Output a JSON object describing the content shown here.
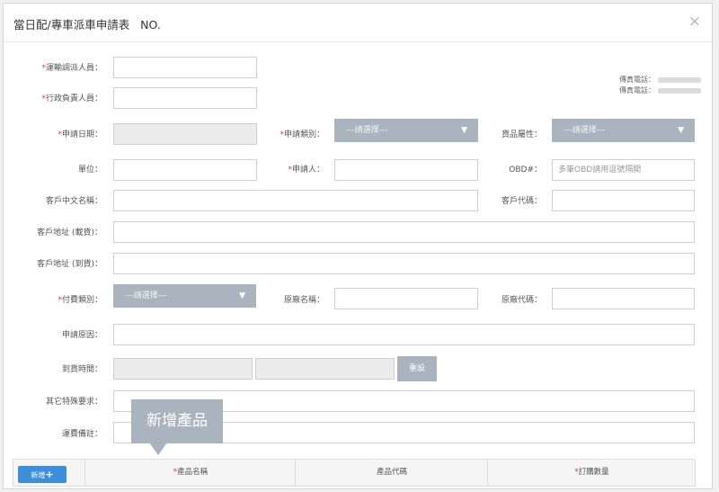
{
  "dialog": {
    "title": "當日配/專車派車申請表",
    "no_label": "NO.",
    "close": "×"
  },
  "phones": {
    "fax": "傳真電話：",
    "tel": "傳真電話："
  },
  "fields": {
    "dispatcher": "運輸調派人員：",
    "admin_owner": "行政負責人員：",
    "apply_date": "申請日期：",
    "apply_type": "申請類別：",
    "apply_type_value": "---請選擇---",
    "goods_attr": "貨品屬性：",
    "goods_attr_value": "---請選擇---",
    "unit": "單位：",
    "applicant": "申請人：",
    "obd": "OBD#：",
    "obd_placeholder": "多筆OBD請用逗號隔開",
    "customer_name": "客戶中文名稱：",
    "customer_code": "客戶代碼：",
    "addr_pickup": "客戶地址 (載貨)：",
    "addr_delivery": "客戶地址 (到貨)：",
    "pay_type": "付費類別：",
    "pay_type_value": "---請選擇---",
    "factory_name": "原廠名稱：",
    "factory_code": "原廠代碼：",
    "reason": "申請原因：",
    "arrival_time": "到貨時間：",
    "reset": "重設",
    "special": "其它特殊要求：",
    "freight_note": "運費備註："
  },
  "tooltip": "新增產品",
  "table": {
    "add_label": "新增",
    "add_icon": "+",
    "columns": [
      "產品名稱",
      "產品代碼",
      "訂購數量"
    ]
  },
  "colors": {
    "required": "#e03b3b",
    "select_bg": "#a9b4bf",
    "add_button": "#3d8edb"
  }
}
